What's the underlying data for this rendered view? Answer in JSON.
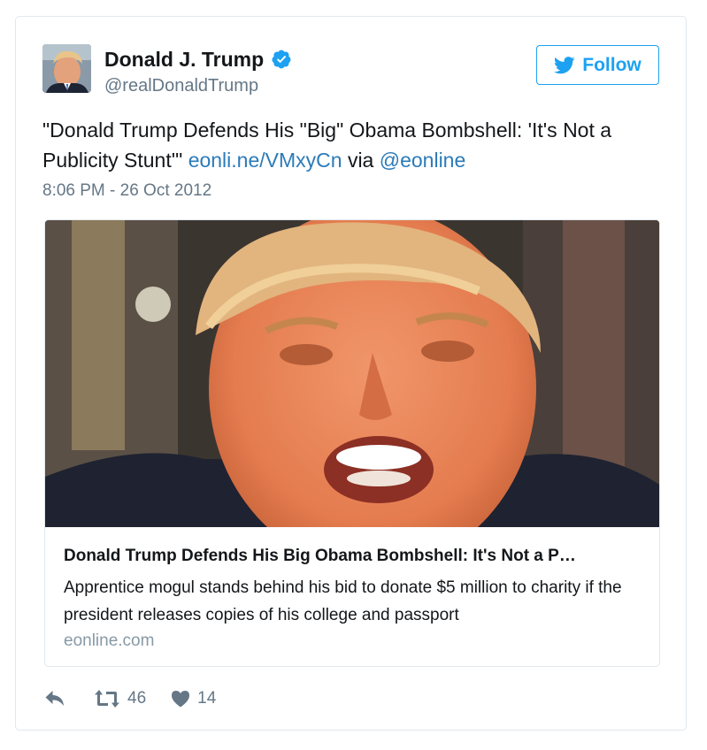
{
  "tweet": {
    "display_name": "Donald J. Trump",
    "handle": "@realDonaldTrump",
    "follow_label": "Follow",
    "text_main": "\"Donald Trump Defends His \"Big\" Obama Bombshell: 'It's Not a Publicity Stunt'\"",
    "link_text": "eonli.ne/VMxyCn",
    "via_text": "via",
    "mention_text": "@eonline",
    "timestamp": "8:06 PM - 26 Oct 2012",
    "verified": true
  },
  "link_card": {
    "title": "Donald Trump Defends His Big Obama Bombshell: It's Not a P…",
    "description": "Apprentice mogul stands behind his bid to donate $5 million to charity if the president releases copies of his college and passport",
    "domain": "eonline.com"
  },
  "actions": {
    "reply_icon": "reply-icon",
    "retweet_icon": "retweet-icon",
    "retweet_count": "46",
    "like_icon": "heart-icon",
    "like_count": "14"
  },
  "colors": {
    "accent": "#1da1f2",
    "link": "#2b7bb9",
    "muted": "#657786",
    "border": "#e1e8ed"
  }
}
